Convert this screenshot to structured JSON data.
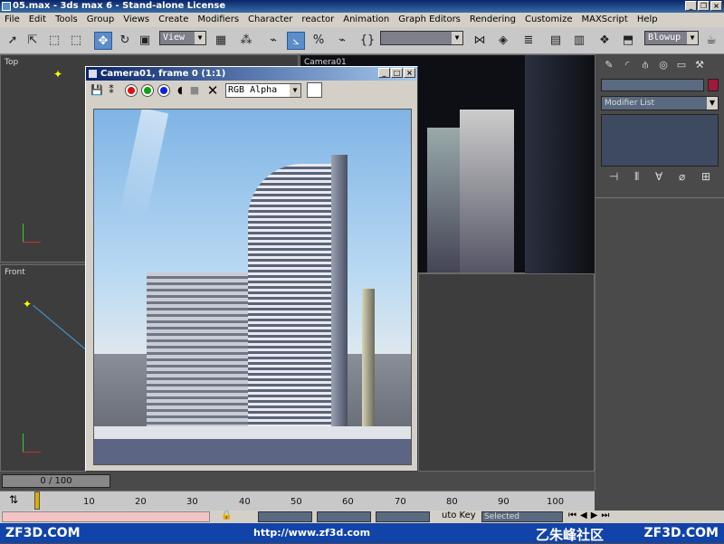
{
  "window": {
    "title": "05.max - 3ds max 6 - Stand-alone License"
  },
  "menu": [
    "File",
    "Edit",
    "Tools",
    "Group",
    "Views",
    "Create",
    "Modifiers",
    "Character",
    "reactor",
    "Animation",
    "Graph Editors",
    "Rendering",
    "Customize",
    "MAXScript",
    "Help"
  ],
  "toolbar": {
    "ref_coord": "View",
    "named_sel": "",
    "blowup": "Blowup"
  },
  "viewports": {
    "top": "Top",
    "front": "Front",
    "camera": "Camera01"
  },
  "vfb": {
    "title": "Camera01, frame 0 (1:1)",
    "channel": "RGB Alpha"
  },
  "cmdpanel": {
    "modifier_list": "Modifier List"
  },
  "time": {
    "slider": "0 / 100",
    "ticks": [
      "10",
      "20",
      "30",
      "40",
      "50",
      "60",
      "70",
      "80",
      "90",
      "100"
    ]
  },
  "status": {
    "auto_key": "uto Key",
    "selected": "Selected"
  },
  "watermark": {
    "left": "ZF3D.COM",
    "center": "http://www.zf3d.com",
    "cn": "乙朱峰社区",
    "right": "ZF3D.COM"
  },
  "colors": {
    "accent": "#5b8dc9",
    "title": "#0a246a",
    "watermark_bg": "#1243a8"
  }
}
